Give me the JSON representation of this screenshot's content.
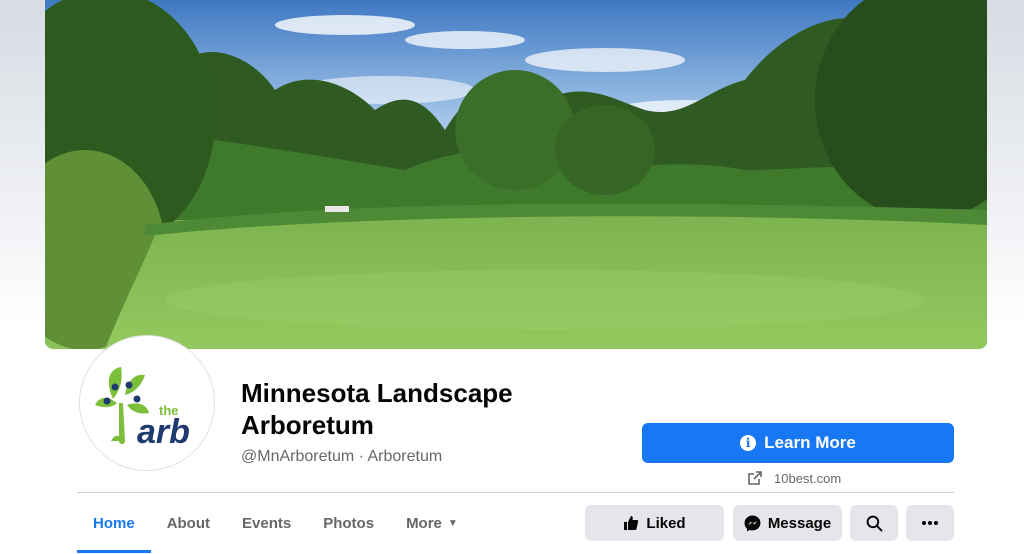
{
  "page": {
    "name": "Minnesota Landscape Arboretum",
    "handle_and_category": "@MnArboretum · Arboretum",
    "logo_text_small": "the",
    "logo_text_big": "arb"
  },
  "cta": {
    "label": "Learn More",
    "link_text": "10best.com"
  },
  "tabs": [
    {
      "label": "Home",
      "active": true
    },
    {
      "label": "About"
    },
    {
      "label": "Events"
    },
    {
      "label": "Photos"
    },
    {
      "label": "More"
    }
  ],
  "actions": {
    "liked_label": "Liked",
    "message_label": "Message",
    "search_icon": "search-icon",
    "more_icon": "more-horizontal-icon"
  },
  "colors": {
    "accent": "#1877f2",
    "secondary_button": "#e4e6eb",
    "logo_navy": "#1e3a6e",
    "logo_green": "#7cbf3a"
  }
}
